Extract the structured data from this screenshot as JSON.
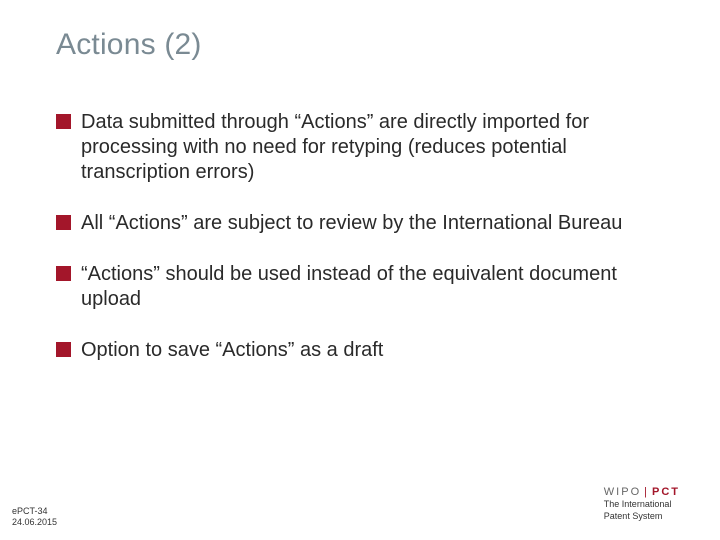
{
  "title": "Actions (2)",
  "bullets": [
    "Data submitted through “Actions” are directly imported for processing with no need for retyping (reduces potential transcription errors)",
    "All “Actions” are subject to review by the International Bureau",
    "“Actions” should be used instead of the equivalent document upload",
    "Option to save “Actions” as a draft"
  ],
  "footer": {
    "code": "ePCT-34",
    "date": "24.06.2015"
  },
  "logo": {
    "wipo": "WIPO",
    "pct": "PCT",
    "sub1": "The International",
    "sub2": "Patent System"
  }
}
